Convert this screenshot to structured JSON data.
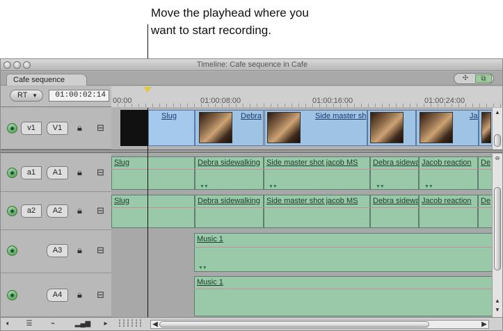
{
  "callout": {
    "text": "Move the playhead where you\nwant to start recording."
  },
  "window": {
    "title": "Timeline: Cafe sequence in Cafe",
    "tab_label": "Cafe sequence",
    "rt_label": "RT",
    "timecode": "01:00:02:14",
    "ruler_labels": [
      "00:00",
      "01:00:08:00",
      "01:00:16:00",
      "01:00:24:00"
    ]
  },
  "tracks": {
    "video": [
      {
        "source": "v1",
        "dest": "V1",
        "clips": [
          "Slug",
          "Debra",
          "Side master sh",
          "Ja"
        ]
      }
    ],
    "audio": [
      {
        "source": "a1",
        "dest": "A1",
        "clips": [
          "Slug",
          "Debra sidewalking",
          "Side master shot jacob MS",
          "Debra sidewa",
          "Jacob reaction",
          "De"
        ]
      },
      {
        "source": "a2",
        "dest": "A2",
        "clips": [
          "Slug",
          "Debra sidewalking",
          "Side master shot jacob MS",
          "Debra sidewa",
          "Jacob reaction",
          "De"
        ]
      },
      {
        "source": "",
        "dest": "A3",
        "clips": [
          "Music 1"
        ]
      },
      {
        "source": "",
        "dest": "A4",
        "clips": [
          "Music 1"
        ]
      }
    ]
  },
  "icons": {
    "target": "track-target-icon",
    "lock": "lock-icon",
    "audio": "audio-enable-icon"
  },
  "colors": {
    "audio_clip": "#99c9a9",
    "video_clip": "#9fc3e3",
    "playhead": "#e3c83a"
  }
}
